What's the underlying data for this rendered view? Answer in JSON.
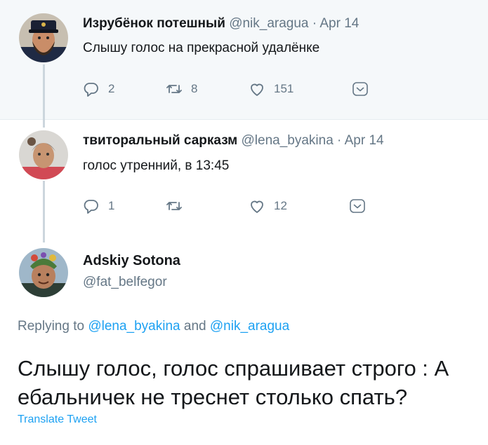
{
  "tweet1": {
    "name": "Изрубёнок потешный",
    "handle": "@nik_aragua",
    "dot": "·",
    "date": "Apr 14",
    "text": "Слышу голос на прекрасной удалёнке",
    "replies": "2",
    "retweets": "8",
    "likes": "151"
  },
  "tweet2": {
    "name": "твиторальный сарказм",
    "handle": "@lena_byakina",
    "dot": "·",
    "date": "Apr 14",
    "text": "голос утренний, в 13:45",
    "replies": "1",
    "retweets": "",
    "likes": "12"
  },
  "main": {
    "name": "Adskiy Sotona",
    "handle": "@fat_belfegor",
    "replying_prefix": "Replying to",
    "reply_to_1": "@lena_byakina",
    "and": "and",
    "reply_to_2": "@nik_aragua",
    "text": "Слышу голос, голос спрашивает строго : А ебальничек не треснет столько спать?",
    "translate": "Translate Tweet"
  },
  "icons": {
    "reply": "reply-icon",
    "retweet": "retweet-icon",
    "like": "heart-icon",
    "more": "chevron-down-icon"
  },
  "colors": {
    "accent": "#1da1f2",
    "muted": "#657786",
    "thread_line": "#ccd6dd",
    "tweet1_bg": "#f5f8fa"
  }
}
